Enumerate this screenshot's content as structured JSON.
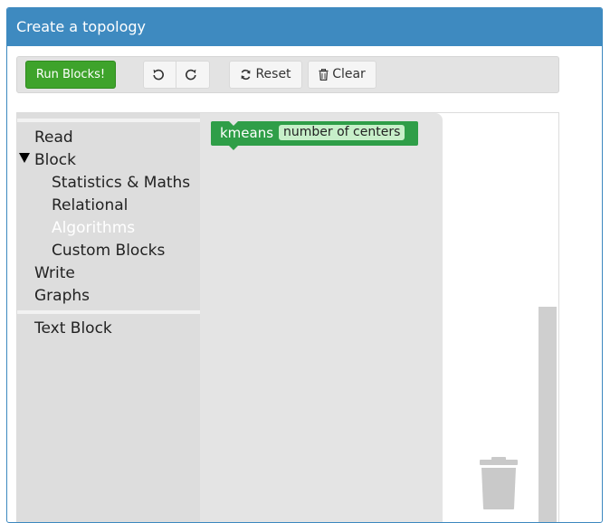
{
  "panel": {
    "title": "Create a topology"
  },
  "toolbar": {
    "run_label": "Run Blocks!",
    "reset_label": "Reset",
    "clear_label": "Clear",
    "undo_icon": "undo-icon",
    "redo_icon": "redo-icon",
    "reset_icon": "refresh-icon",
    "clear_icon": "trash-icon"
  },
  "toolbox": {
    "categories": [
      {
        "label": "Read"
      },
      {
        "label": "Block"
      },
      {
        "label": "Statistics & Maths"
      },
      {
        "label": "Relational"
      },
      {
        "label": "Algorithms"
      },
      {
        "label": "Custom Blocks"
      },
      {
        "label": "Write"
      },
      {
        "label": "Graphs"
      },
      {
        "label": "Text Block"
      }
    ]
  },
  "flyout": {
    "block": {
      "label": "kmeans",
      "field": "number of centers"
    }
  },
  "colors": {
    "header": "#3e8ac0",
    "run_button": "#3ea32b",
    "block": "#2f9e48",
    "block_field": "#c7efc9"
  }
}
